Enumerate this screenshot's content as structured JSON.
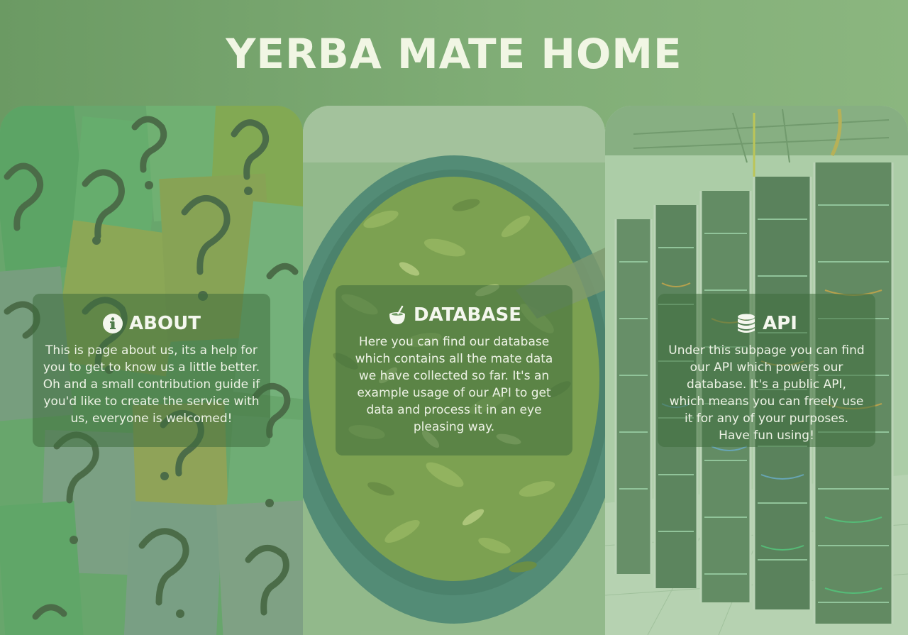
{
  "header": {
    "title": "YERBA MATE HOME"
  },
  "panels": [
    {
      "id": "about",
      "title": "ABOUT",
      "icon": "info-circle-icon",
      "text": "This is page about us, its a help for you to get to know us a little better. Oh and a small contribution guide if you'd like to create the service with us, everyone is welcomed!"
    },
    {
      "id": "database",
      "title": "DATABASE",
      "icon": "mate-gourd-icon",
      "text": "Here you can find our database which contains all the mate data we have collected so far. It's an example usage of our API to get data and process it in an eye pleasing way."
    },
    {
      "id": "api",
      "title": "API",
      "icon": "database-icon",
      "text": "Under this subpage you can find our API which powers our database. It's a public API, which means you can freely use it for any of your purposes. Have fun using!"
    }
  ],
  "colors": {
    "header_bg": "#74a36b",
    "title_text": "#f1f6e4",
    "card_bg": "#406e3e",
    "card_text": "#eef3e6"
  }
}
